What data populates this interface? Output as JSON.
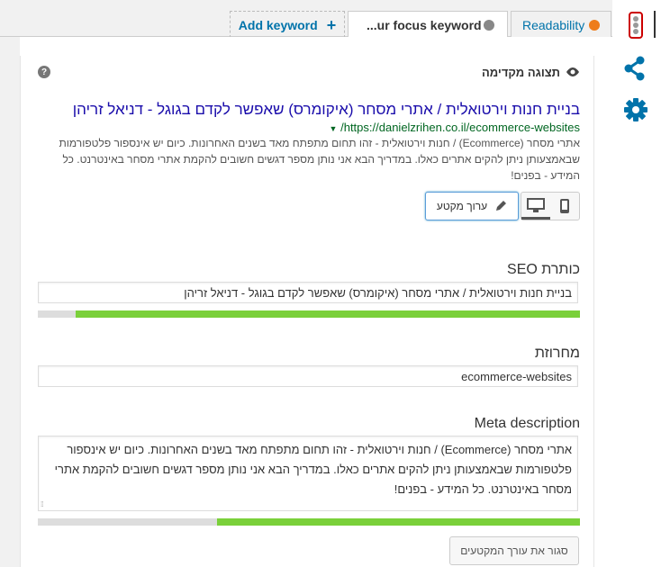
{
  "tabs": {
    "readability": {
      "label": "Readability",
      "dot_color": "#ee7c1b"
    },
    "focus_keyword": {
      "label": "...ur focus keyword",
      "dot_color": "#888888"
    },
    "add_keyword": {
      "label": "Add keyword",
      "icon": "plus-icon"
    }
  },
  "rail": {
    "icons": [
      "traffic-light-icon",
      "share-icon",
      "gear-icon"
    ],
    "share_color": "#0073aa"
  },
  "preview": {
    "heading": "תצוגה מקדימה",
    "eye_icon": "eye-icon",
    "help_icon": "?",
    "snippet_title": "בניית חנות וירטואלית / אתרי מסחר (איקומרס) שאפשר לקדם בגוגל - דניאל זריהן",
    "snippet_url": "https://danielzrihen.co.il/ecommerce-websites/",
    "snippet_description": "אתרי מסחר (Ecommerce) / חנות וירטואלית - זהו תחום מתפתח מאד בשנים האחרונות. כיום יש אינספור פלטפורמות שבאמצעותן ניתן להקים אתרים כאלו. במדריך הבא אני נותן מספר דגשים חשובים להקמת אתרי מסחר באינטרנט. כל המידע - בפנים!",
    "edit_snippet_label": "ערוך מקטע"
  },
  "fields": {
    "seo_title": {
      "label": "כותרת SEO",
      "value": "בניית חנות וירטואלית / אתרי מסחר (איקומרס) שאפשר לקדם בגוגל - דניאל זריהן",
      "progress": 0.93,
      "progress_color": "#7ad03a"
    },
    "slug": {
      "label": "מחרוזת",
      "value": "ecommerce-websites"
    },
    "meta_description": {
      "label": "Meta description",
      "value": "אתרי מסחר (Ecommerce) / חנות וירטואלית - זהו תחום מתפתח מאד בשנים האחרונות. כיום יש אינספור פלטפורמות שבאמצעותן ניתן להקים אתרים כאלו. במדריך הבא אני נותן מספר דגשים חשובים להקמת אתרי מסחר באינטרנט. כל המידע - בפנים!",
      "progress": 0.67,
      "progress_color": "#7ad03a"
    }
  },
  "close_editor_label": "סגור את עורך המקטעים"
}
